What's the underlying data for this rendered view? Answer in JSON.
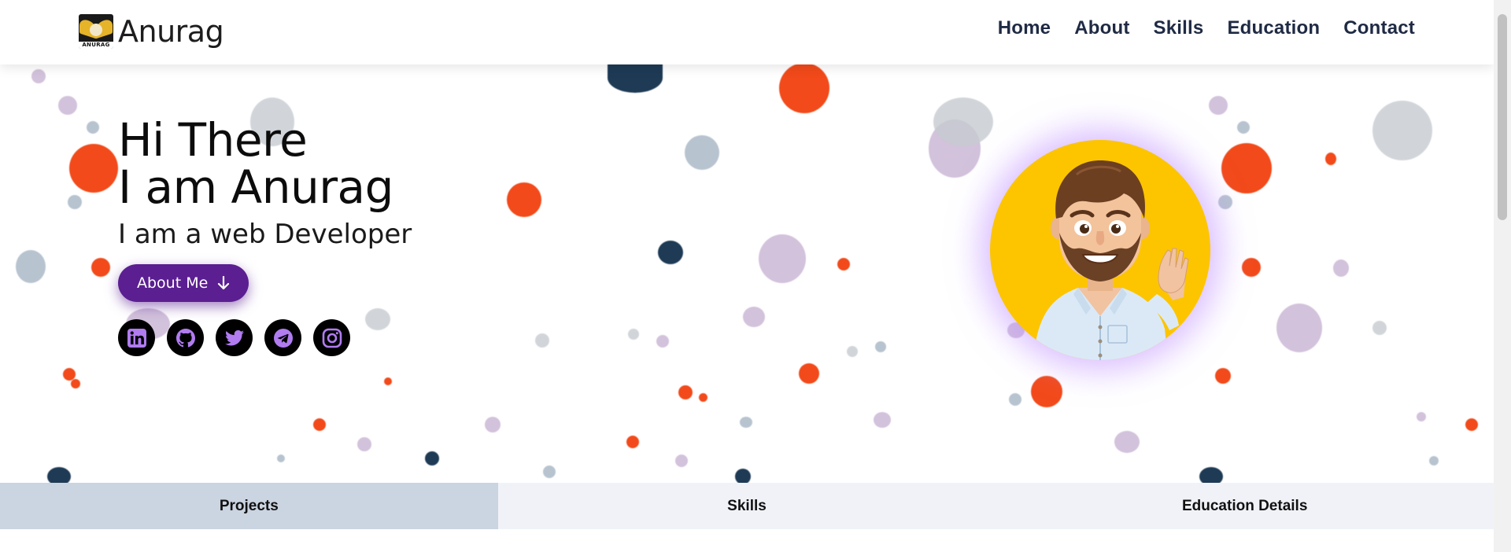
{
  "brand": {
    "name": "Anurag",
    "logo_text": "ANURAG"
  },
  "nav": {
    "items": [
      {
        "label": "Home"
      },
      {
        "label": "About"
      },
      {
        "label": "Skills"
      },
      {
        "label": "Education"
      },
      {
        "label": "Contact"
      }
    ]
  },
  "hero": {
    "title_line1": "Hi There",
    "title_line2": "I am Anurag",
    "subtitle": "I am a web Developer",
    "cta_label": "About Me",
    "cta_icon": "arrow-down-icon"
  },
  "socials": [
    {
      "name": "linkedin-icon"
    },
    {
      "name": "github-icon"
    },
    {
      "name": "twitter-icon"
    },
    {
      "name": "telegram-icon"
    },
    {
      "name": "instagram-icon"
    }
  ],
  "tabs": [
    {
      "label": "Projects",
      "active": true
    },
    {
      "label": "Skills",
      "active": false
    },
    {
      "label": "Education Details",
      "active": false
    }
  ],
  "colors": {
    "accent": "#5b1f91",
    "social_icon": "#b07cf0",
    "avatar_bg": "#fcc500",
    "tab_active": "#cbd4e1",
    "tab_inactive": "#f0f2f7"
  }
}
